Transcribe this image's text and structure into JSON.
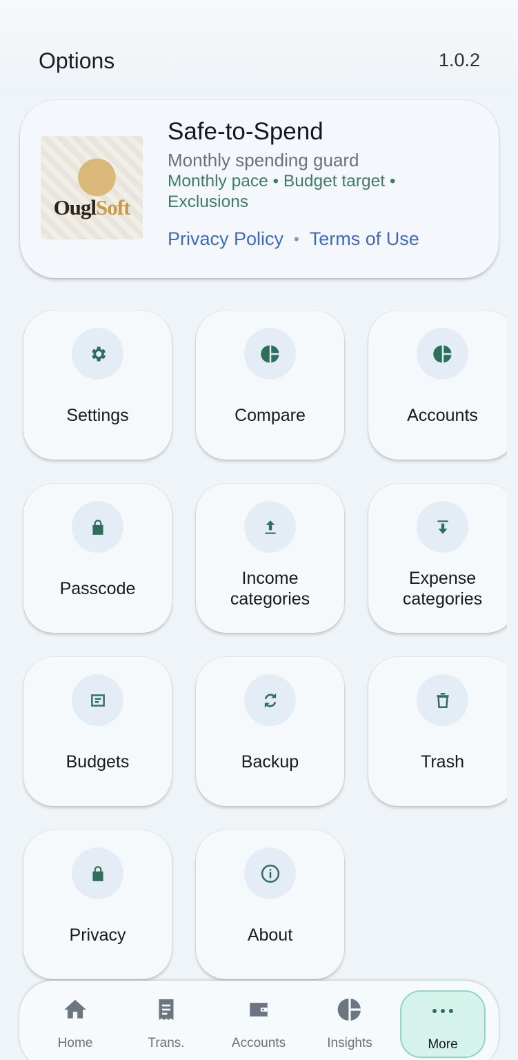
{
  "header": {
    "title": "Options",
    "version": "1.0.2"
  },
  "app": {
    "name": "Safe-to-Spend",
    "subtitle": "Monthly spending guard",
    "features": "Monthly pace • Budget target • Exclusions",
    "privacy_link": "Privacy Policy",
    "separator": "•",
    "terms_link": "Terms of Use",
    "logo_text_a": "Ougl",
    "logo_text_b": "Soft"
  },
  "tiles": [
    {
      "label": "Settings",
      "icon": "gear-icon"
    },
    {
      "label": "Compare",
      "icon": "pie-chart-icon"
    },
    {
      "label": "Accounts",
      "icon": "pie-chart-icon"
    },
    {
      "label": "Passcode",
      "icon": "lock-icon"
    },
    {
      "label": "Income categories",
      "icon": "upload-arrow-icon"
    },
    {
      "label": "Expense categories",
      "icon": "download-arrow-icon"
    },
    {
      "label": "Budgets",
      "icon": "budget-icon"
    },
    {
      "label": "Backup",
      "icon": "sync-icon"
    },
    {
      "label": "Trash",
      "icon": "trash-icon"
    },
    {
      "label": "Privacy",
      "icon": "lock-icon"
    },
    {
      "label": "About",
      "icon": "info-icon"
    }
  ],
  "nav": [
    {
      "label": "Home",
      "icon": "home-icon"
    },
    {
      "label": "Trans.",
      "icon": "receipt-icon"
    },
    {
      "label": "Accounts",
      "icon": "wallet-icon"
    },
    {
      "label": "Insights",
      "icon": "pie-chart-icon"
    },
    {
      "label": "More",
      "icon": "more-dots-icon",
      "active": true
    }
  ],
  "colors": {
    "accent": "#3f7d62",
    "link": "#3f69bd",
    "active_nav": "#d5f3ea"
  }
}
